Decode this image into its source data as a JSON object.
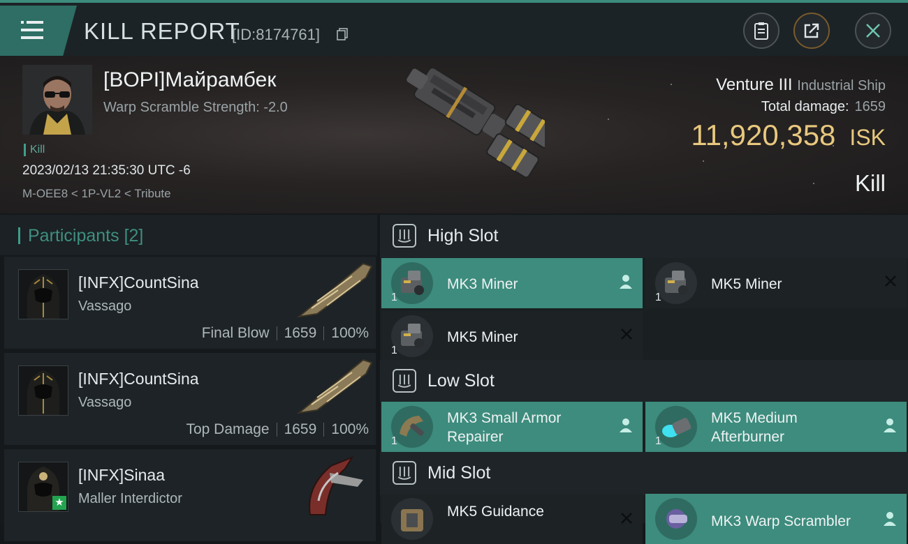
{
  "header": {
    "title": "KILL REPORT",
    "report_id": "[ID:8174761]",
    "buttons": [
      "clipboard-icon",
      "share-icon",
      "close-icon"
    ]
  },
  "victim": {
    "name": "[BOPI]Майрамбек",
    "warp_scramble": "Warp Scramble Strength: -2.0",
    "kill_tag": "Kill",
    "timestamp": "2023/02/13 21:35:30 UTC -6",
    "location": "M-OEE8 < 1P-VL2 < Tribute",
    "ship": "Venture III",
    "ship_class": "Industrial Ship",
    "total_damage_label": "Total damage:",
    "total_damage_value": "1659",
    "isk_value": "11,920,358",
    "isk_unit": "ISK",
    "result": "Kill"
  },
  "participants": {
    "title": "Participants",
    "count": "[2]",
    "rows": [
      {
        "name": "[INFX]CountSina",
        "ship": "Vassago",
        "role": "Final Blow",
        "damage": "1659",
        "percent": "100%"
      },
      {
        "name": "[INFX]CountSina",
        "ship": "Vassago",
        "role": "Top Damage",
        "damage": "1659",
        "percent": "100%"
      },
      {
        "name": "[INFX]Sinaa",
        "ship": "Maller Interdictor"
      }
    ]
  },
  "fitting": {
    "high": {
      "title": "High Slot",
      "items": [
        {
          "name": "MK3 Miner",
          "qty": "1",
          "status": "fitted"
        },
        {
          "name": "MK5 Miner",
          "qty": "1",
          "status": "destroyed"
        },
        {
          "name": "MK5 Miner",
          "qty": "1",
          "status": "destroyed"
        }
      ]
    },
    "low": {
      "title": "Low Slot",
      "items": [
        {
          "name_line1": "MK3 Small Armor",
          "name_line2": "Repairer",
          "qty": "1",
          "status": "fitted"
        },
        {
          "name_line1": "MK5 Medium",
          "name_line2": "Afterburner",
          "qty": "1",
          "status": "fitted"
        }
      ]
    },
    "mid": {
      "title": "Mid Slot",
      "items": [
        {
          "name": "MK5 Guidance",
          "status": "destroyed"
        },
        {
          "name": "MK3 Warp Scrambler",
          "status": "fitted"
        }
      ]
    }
  },
  "colors": {
    "accent": "#3f9d8a",
    "isk_gold": "#e8c87e",
    "fitted_slot": "#3d8c7d"
  }
}
